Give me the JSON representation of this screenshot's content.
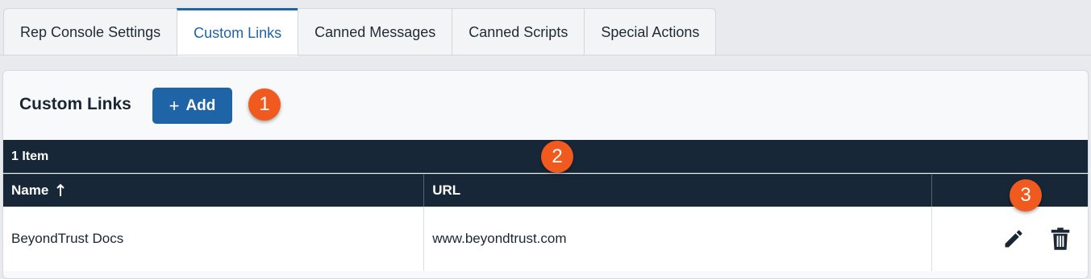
{
  "tabs": [
    {
      "label": "Rep Console Settings",
      "active": false
    },
    {
      "label": "Custom Links",
      "active": true
    },
    {
      "label": "Canned Messages",
      "active": false
    },
    {
      "label": "Canned Scripts",
      "active": false
    },
    {
      "label": "Special Actions",
      "active": false
    }
  ],
  "panel": {
    "title": "Custom Links",
    "add_button": {
      "icon": "plus-icon",
      "label": "Add"
    }
  },
  "callouts": [
    "1",
    "2",
    "3"
  ],
  "table": {
    "count_label": "1 Item",
    "columns": [
      {
        "label": "Name",
        "sort": "ascending",
        "sort_icon": "arrow-up-icon"
      },
      {
        "label": "URL"
      },
      {
        "label": ""
      }
    ],
    "rows": [
      {
        "name": "BeyondTrust Docs",
        "url": "www.beyondtrust.com",
        "actions": [
          "pencil-icon",
          "trash-icon"
        ]
      }
    ]
  },
  "colors": {
    "accent": "#1f64a6",
    "table_header": "#172737",
    "callout": "#f05a1e"
  }
}
